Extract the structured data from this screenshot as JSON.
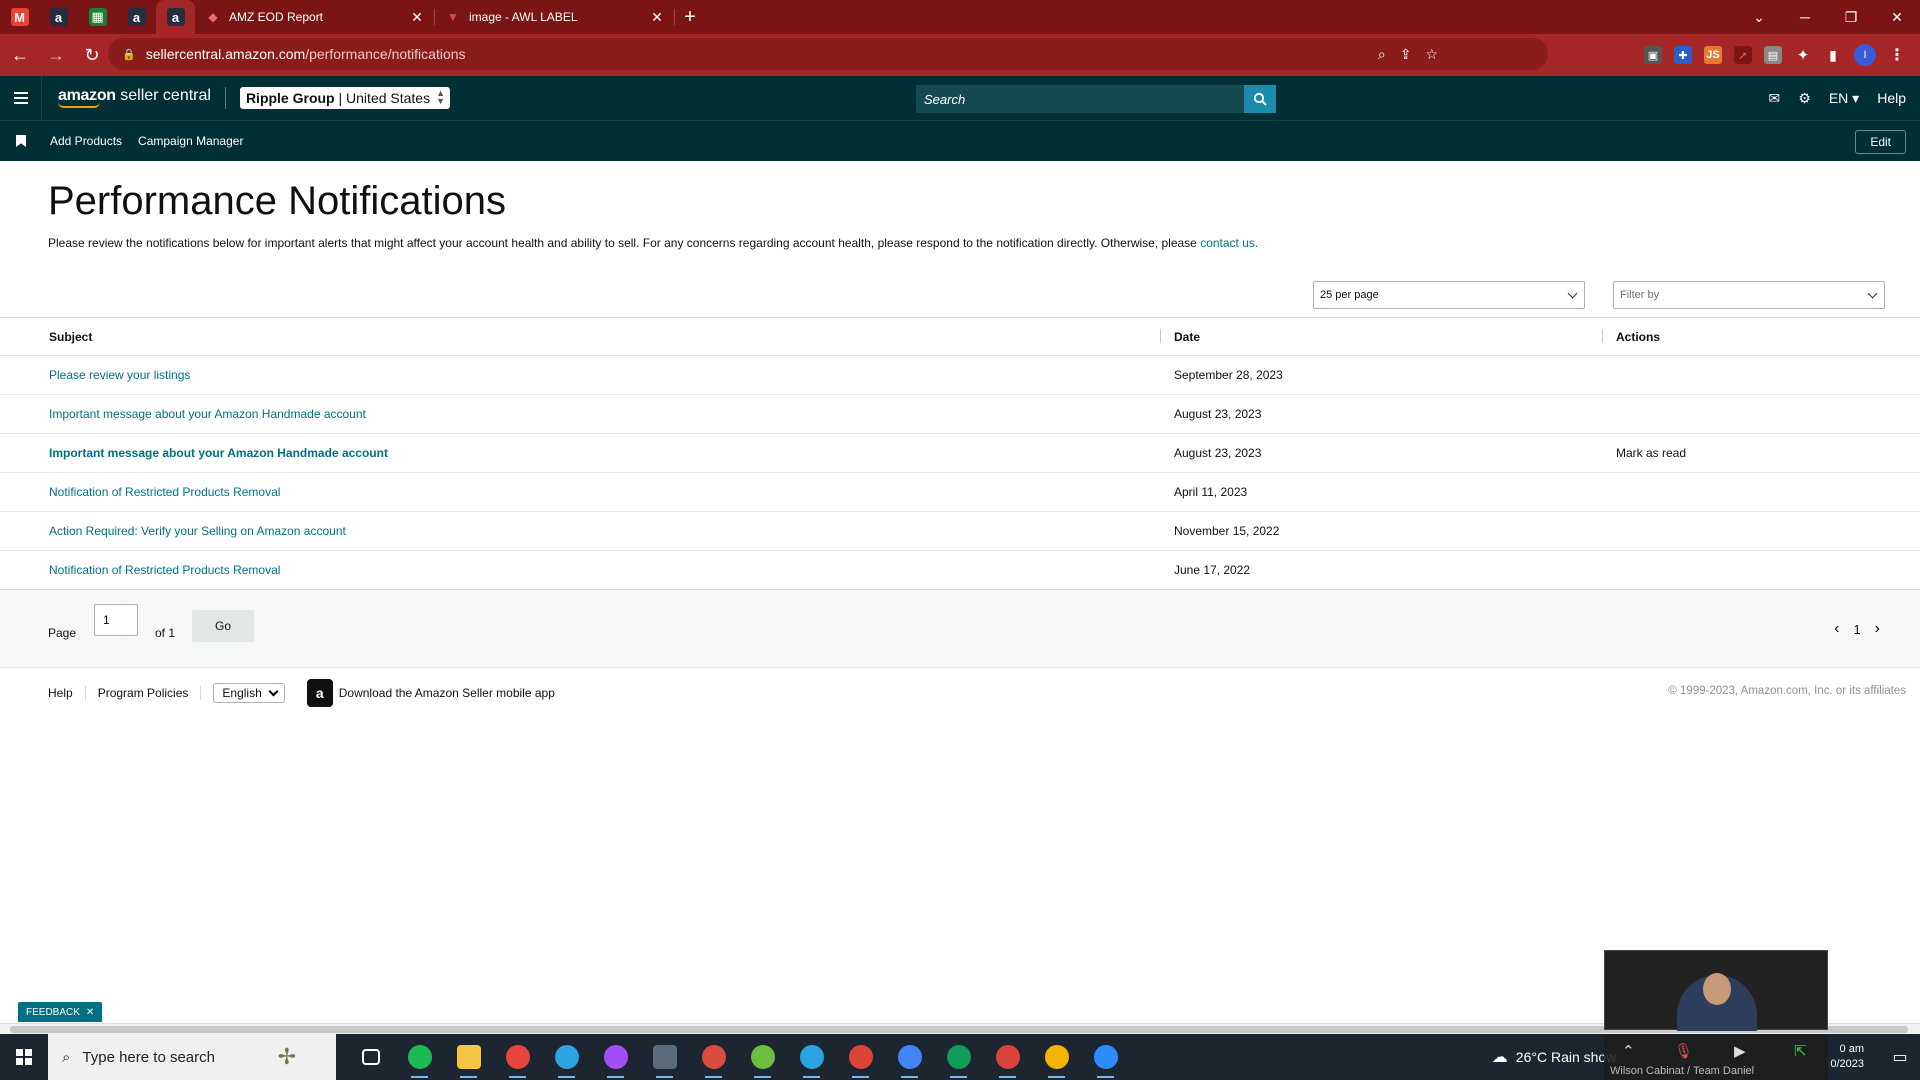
{
  "browser": {
    "pinned_tabs": [
      {
        "icon": "gmail-icon",
        "glyph": "M",
        "color": "#ea4335"
      },
      {
        "icon": "amazon-icon",
        "glyph": "a",
        "color": "#232f3e"
      },
      {
        "icon": "sheets-icon",
        "glyph": "▦",
        "color": "#188038"
      },
      {
        "icon": "amazon-icon",
        "glyph": "a",
        "color": "#232f3e"
      },
      {
        "icon": "amazon-icon",
        "glyph": "a",
        "color": "#232f3e"
      }
    ],
    "tabs": [
      {
        "title": "AMZ EOD Report",
        "icon": "asana-icon",
        "glyph": "◆",
        "color": "#f06a6a"
      },
      {
        "title": "image - AWL LABEL",
        "icon": "clickup-icon",
        "glyph": "▼",
        "color": "#e04848"
      }
    ],
    "url_host": "sellercentral.amazon.com",
    "url_path": "/performance/notifications"
  },
  "header": {
    "logo_brand": "amazon",
    "logo_product": "seller central",
    "account": "Ripple Group",
    "marketplace": "United States",
    "search_placeholder": "Search",
    "language": "EN",
    "help": "Help"
  },
  "subnav": {
    "items": [
      "Add Products",
      "Campaign Manager"
    ],
    "edit": "Edit"
  },
  "page": {
    "title": "Performance Notifications",
    "intro": "Please review the notifications below for important alerts that might affect your account health and ability to sell. For any concerns regarding account health, please respond to the notification directly. Otherwise, please ",
    "contact_link": "contact us.",
    "per_page": "25 per page",
    "filter_placeholder": "Filter by"
  },
  "table": {
    "headers": {
      "subject": "Subject",
      "date": "Date",
      "actions": "Actions"
    },
    "rows": [
      {
        "subject": "Please review your listings",
        "date": "September 28, 2023",
        "action": "",
        "unread": false
      },
      {
        "subject": "Important message about your Amazon Handmade account",
        "date": "August 23, 2023",
        "action": "",
        "unread": false
      },
      {
        "subject": "Important message about your Amazon Handmade account",
        "date": "August 23, 2023",
        "action": "Mark as read",
        "unread": true
      },
      {
        "subject": "Notification of Restricted Products Removal",
        "date": "April 11, 2023",
        "action": "",
        "unread": false
      },
      {
        "subject": "Action Required: Verify your Selling on Amazon account",
        "date": "November 15, 2022",
        "action": "",
        "unread": false
      },
      {
        "subject": "Notification of Restricted Products Removal",
        "date": "June 17, 2022",
        "action": "",
        "unread": false
      }
    ]
  },
  "pager": {
    "page_label": "Page",
    "page_value": "1",
    "of_label": "of 1",
    "go": "Go",
    "current": "1"
  },
  "footer": {
    "help": "Help",
    "policies": "Program Policies",
    "language": "English",
    "app_text": "Download the Amazon Seller mobile app",
    "copyright": "© 1999-2023, Amazon.com, Inc. or its affiliates"
  },
  "feedback": "FEEDBACK",
  "taskbar": {
    "search_placeholder": "Type here to search",
    "weather": "26°C  Rain show",
    "time": "0 am",
    "date": "0/2023",
    "meeting_caption": "Wilson Cabinat / Team Daniel",
    "apps": [
      {
        "name": "task-view-icon",
        "color": "#1c2530"
      },
      {
        "name": "spotify-icon",
        "color": "#1db954"
      },
      {
        "name": "file-explorer-icon",
        "color": "#f5c542"
      },
      {
        "name": "chrome-icon",
        "color": "#e8453c"
      },
      {
        "name": "telegram-icon",
        "color": "#2aa3e0"
      },
      {
        "name": "messenger-icon",
        "color": "#a34df5"
      },
      {
        "name": "calculator-icon",
        "color": "#5a6b7c"
      },
      {
        "name": "chrome-profile-icon",
        "color": "#d94b3d"
      },
      {
        "name": "utorrent-icon",
        "color": "#6cbf3e"
      },
      {
        "name": "telegram-icon",
        "color": "#2aa3e0"
      },
      {
        "name": "chrome-profile-icon",
        "color": "#db4437"
      },
      {
        "name": "chrome-profile-icon",
        "color": "#4285f4"
      },
      {
        "name": "chrome-profile-icon",
        "color": "#0f9d58"
      },
      {
        "name": "chrome-profile-icon",
        "color": "#db4437"
      },
      {
        "name": "chrome-profile-icon",
        "color": "#f4b400"
      },
      {
        "name": "zoom-icon",
        "color": "#2d8cff"
      }
    ]
  }
}
